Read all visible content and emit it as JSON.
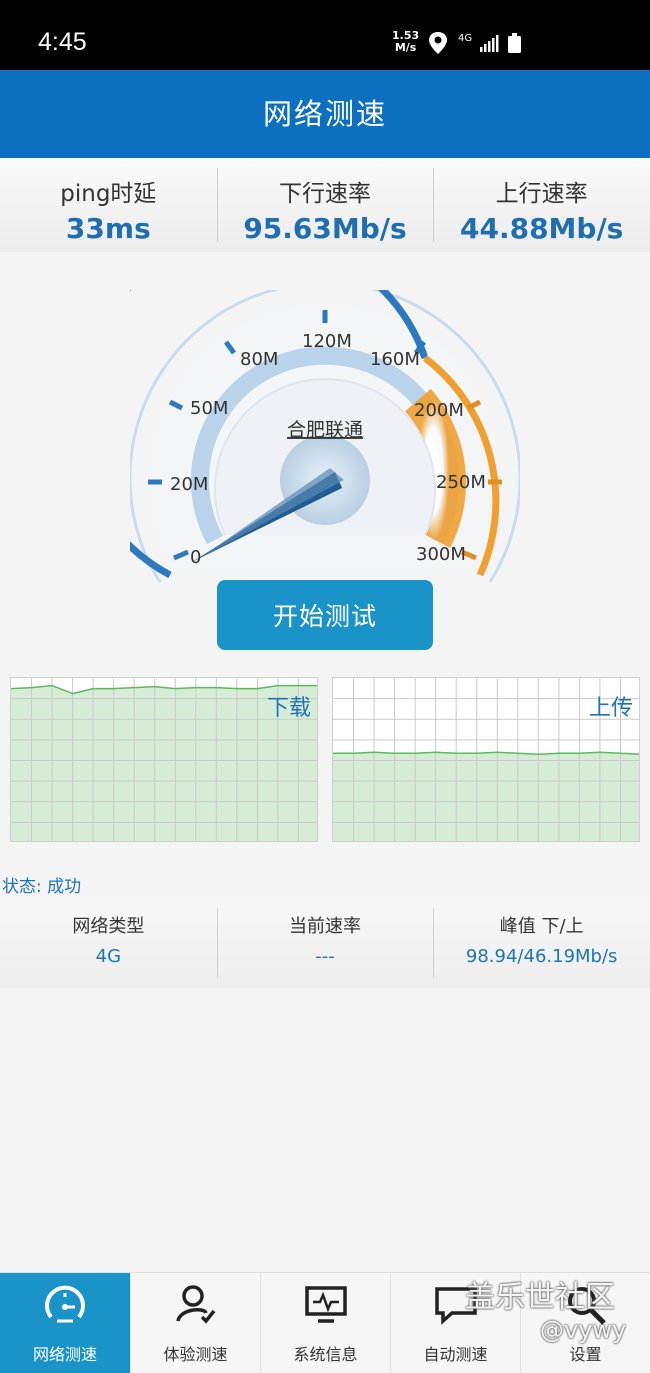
{
  "status_bar": {
    "time": "4:45",
    "net_speed": "1.53",
    "net_speed_unit": "M/s",
    "network": "4G"
  },
  "header": {
    "title": "网络测速"
  },
  "summary": [
    {
      "label": "ping时延",
      "value": "33ms"
    },
    {
      "label": "下行速率",
      "value": "95.63Mb/s"
    },
    {
      "label": "上行速率",
      "value": "44.88Mb/s"
    }
  ],
  "gauge": {
    "carrier": "合肥联通",
    "ticks": [
      "0",
      "20M",
      "50M",
      "80M",
      "120M",
      "160M",
      "200M",
      "250M",
      "300M"
    ],
    "needle_value": "0"
  },
  "start_button": "开始测试",
  "graphs": {
    "download_label": "下载",
    "upload_label": "上传",
    "download_level": 0.96,
    "upload_level": 0.55
  },
  "state": "状态: 成功",
  "info": [
    {
      "label": "网络类型",
      "value": "4G"
    },
    {
      "label": "当前速率",
      "value": "---"
    },
    {
      "label": "峰值  下/上",
      "value": "98.94/46.19Mb/s"
    }
  ],
  "nav": [
    {
      "label": "网络测速",
      "icon": "speedometer-icon",
      "active": true
    },
    {
      "label": "体验测速",
      "icon": "user-check-icon",
      "active": false
    },
    {
      "label": "系统信息",
      "icon": "monitor-icon",
      "active": false
    },
    {
      "label": "自动测速",
      "icon": "chat-icon",
      "active": false
    },
    {
      "label": "设置",
      "icon": "search-icon",
      "active": false
    }
  ],
  "watermark": {
    "line1": "盖乐世社区",
    "line2": "@vywy"
  },
  "colors": {
    "primary": "#0d6fbf",
    "accent": "#1a93c8",
    "value_blue": "#1f6eaf",
    "orange": "#f0a030",
    "graph_fill": "#d6ecd6"
  }
}
